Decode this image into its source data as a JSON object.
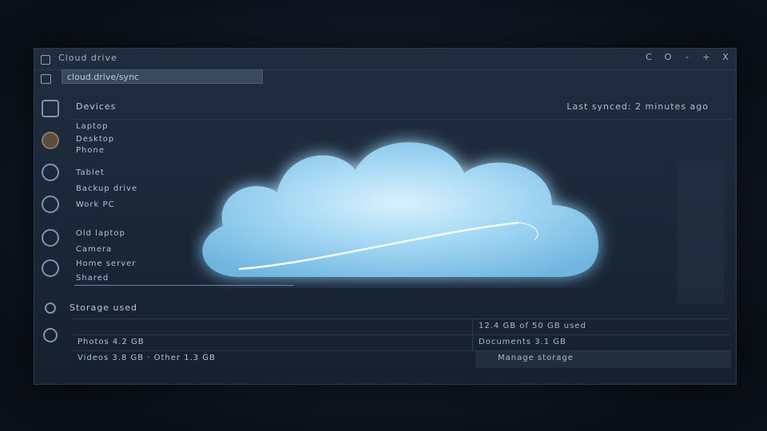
{
  "window": {
    "title": "Cloud drive",
    "controls": [
      "C",
      "O",
      "-",
      "+",
      "X"
    ]
  },
  "address": {
    "value": "cloud.drive/sync"
  },
  "header": {
    "title": "Devices",
    "status": "Last synced: 2 minutes ago"
  },
  "list": {
    "items": [
      "Laptop",
      "Desktop",
      "Phone",
      "Tablet",
      "Backup drive",
      "Work PC",
      "Old laptop",
      "Camera",
      "Home server",
      "Shared"
    ]
  },
  "storage": {
    "label": "Storage used",
    "rows": [
      {
        "left": "",
        "right": "12.4 GB of 50 GB used"
      },
      {
        "left": "Photos 4.2 GB",
        "right": "Documents 3.1 GB"
      },
      {
        "left": "Videos 3.8 GB · Other 1.3 GB",
        "right": "Manage storage"
      }
    ]
  },
  "colors": {
    "accent": "#7fc4ec",
    "cloud_glow": "#a8dcf7"
  },
  "icons": {
    "rail": [
      "folder-icon",
      "user-icon",
      "settings-icon",
      "shield-icon",
      "globe-icon",
      "chat-icon"
    ]
  }
}
